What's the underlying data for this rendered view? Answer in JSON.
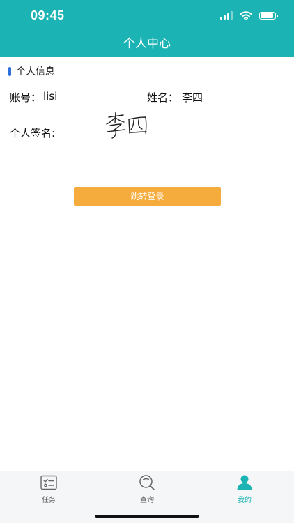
{
  "status_bar": {
    "time": "09:45"
  },
  "header": {
    "title": "个人中心"
  },
  "section": {
    "title": "个人信息"
  },
  "profile": {
    "account_label": "账号：",
    "account_value": "lisi",
    "name_label": "姓名：",
    "name_value": "李四",
    "signature_label": "个人签名:",
    "signature_text": "李四"
  },
  "actions": {
    "login_label": "跳转登录"
  },
  "tabbar": {
    "tabs": [
      {
        "label": "任务",
        "icon": "task-list-icon"
      },
      {
        "label": "查询",
        "icon": "search-icon"
      },
      {
        "label": "我的",
        "icon": "user-icon",
        "active": true
      }
    ]
  },
  "colors": {
    "primary": "#1bb3b3",
    "accent_button": "#f6ac3c",
    "section_accent": "#2f6fdc"
  }
}
